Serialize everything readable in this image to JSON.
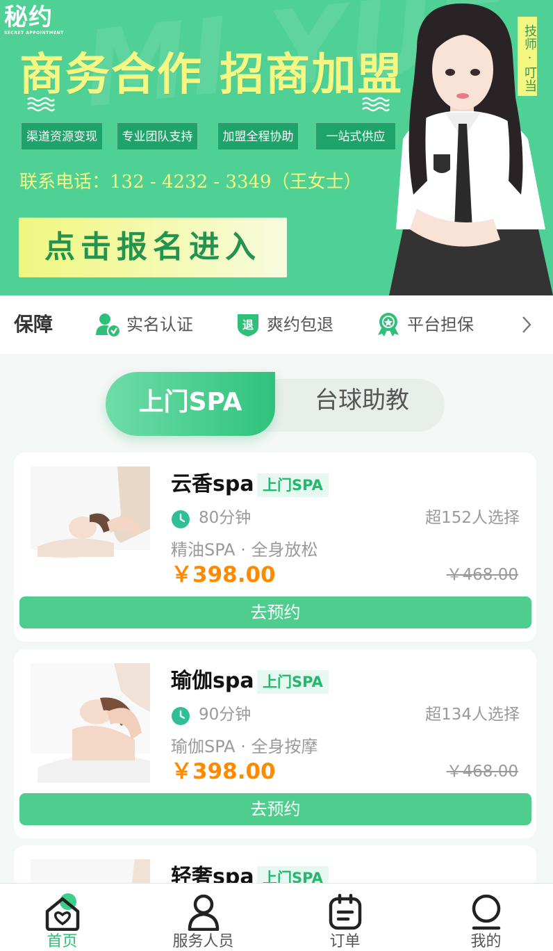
{
  "banner": {
    "logo_text": "秘约",
    "logo_subtitle": "SECRET APPOINTMENT",
    "watermark": "MI YUE",
    "headline": "商务合作 招商加盟",
    "tags": [
      "渠道资源变现",
      "专业团队支持",
      "加盟全程协助",
      "一站式供应"
    ],
    "contact": "联系电话：132 - 4232 - 3349（王女士）",
    "signup_label": "点击报名进入",
    "tech_badge": "技师·叮当"
  },
  "guarantee": {
    "title": "保障",
    "items": [
      {
        "label": "实名认证",
        "icon": "verified-user-icon"
      },
      {
        "label": "爽约包退",
        "icon": "refund-shield-icon"
      },
      {
        "label": "平台担保",
        "icon": "award-ribbon-icon"
      }
    ],
    "more_icon": "chevron-right-icon"
  },
  "segment": {
    "tabs": [
      "上门SPA",
      "台球助教"
    ],
    "active_index": 0
  },
  "cards": [
    {
      "name": "云香spa",
      "badge": "上门SPA",
      "duration": "80分钟",
      "sold": "超152人选择",
      "desc": "精油SPA · 全身放松",
      "price": "￥398.00",
      "original_price": "￥468.00",
      "button": "去预约"
    },
    {
      "name": "瑜伽spa",
      "badge": "上门SPA",
      "duration": "90分钟",
      "sold": "超134人选择",
      "desc": "瑜伽SPA · 全身按摩",
      "price": "￥398.00",
      "original_price": "￥468.00",
      "button": "去预约"
    },
    {
      "name": "轻奢spa",
      "badge": "上门SPA",
      "duration": "",
      "sold": "",
      "desc": "",
      "price": "",
      "original_price": "",
      "button": ""
    }
  ],
  "tabbar": {
    "items": [
      {
        "label": "首页",
        "icon": "home-heart-icon",
        "active": true
      },
      {
        "label": "服务人员",
        "icon": "person-icon",
        "active": false
      },
      {
        "label": "订单",
        "icon": "calendar-icon",
        "active": false
      },
      {
        "label": "我的",
        "icon": "profile-icon",
        "active": false
      }
    ]
  },
  "colors": {
    "brand_green": "#4fd094",
    "button_green": "#4fcd8e",
    "price_orange": "#ff8a00",
    "headline_yellow": "#f4f883"
  }
}
